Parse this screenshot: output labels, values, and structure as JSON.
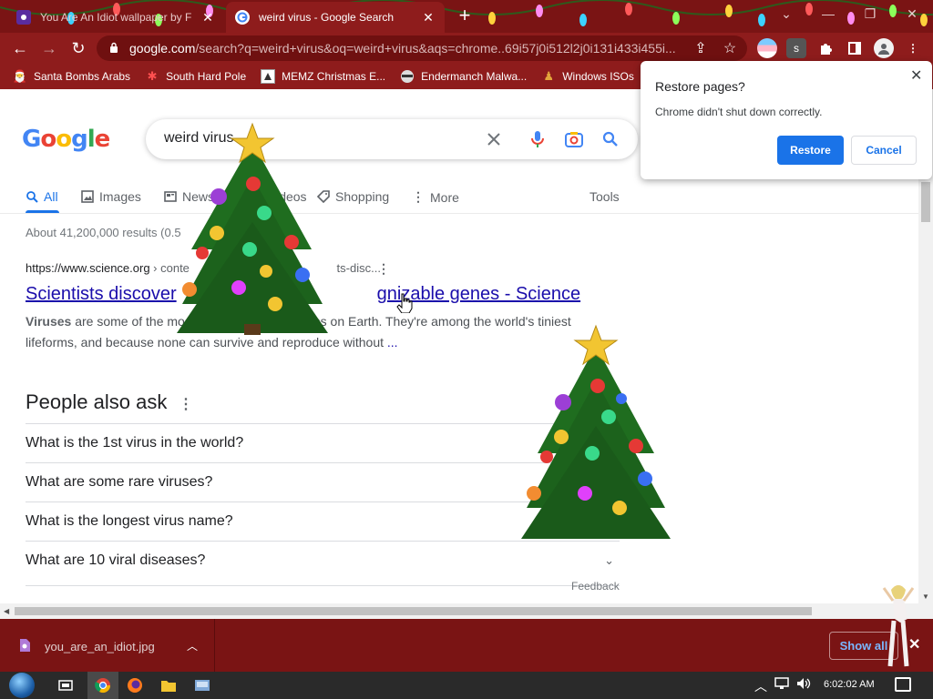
{
  "browser": {
    "tabs": [
      {
        "title": "You Are An Idiot wallpaper by F",
        "active": false
      },
      {
        "title": "weird virus - Google Search",
        "active": true
      }
    ],
    "new_tab": "+",
    "url_host": "google.com",
    "url_path": "/search?q=weird+virus&oq=weird+virus&aqs=chrome..69i57j0i512l2j0i131i433i455i...",
    "bookmarks": [
      {
        "label": "Santa Bombs Arabs",
        "icon": "santa-icon"
      },
      {
        "label": "South Hard Pole",
        "icon": "snowflake-icon"
      },
      {
        "label": "MEMZ Christmas E...",
        "icon": "memz-icon"
      },
      {
        "label": "Endermanch Malwa...",
        "icon": "raccoon-icon"
      },
      {
        "label": "Windows ISOs",
        "icon": "windows-user-icon"
      }
    ],
    "extension_letter": "s"
  },
  "search": {
    "query": "weird virus",
    "logo_letters": [
      "G",
      "o",
      "o",
      "g",
      "l",
      "e"
    ],
    "logo_colors": [
      "#4285f4",
      "#ea4335",
      "#fbbc05",
      "#4285f4",
      "#34a853",
      "#ea4335"
    ],
    "tabs": [
      {
        "label": "All",
        "icon": "search-icon",
        "selected": true
      },
      {
        "label": "Images",
        "icon": "image-icon"
      },
      {
        "label": "News",
        "icon": "news-icon"
      },
      {
        "label": "Videos",
        "icon": "video-icon"
      },
      {
        "label": "Shopping",
        "icon": "tag-icon"
      },
      {
        "label": "More",
        "icon": "more-vert-icon"
      }
    ],
    "tools": "Tools",
    "stats": "About 41,200,000 results (0.5",
    "result": {
      "cite_domain": "https://www.science.org",
      "cite_crumb": " › conte",
      "cite_tail": "ts-disc...",
      "title": "Scientists discover",
      "title_end": "gnizable genes - Science",
      "snippet_bold": "Viruses",
      "snippet_1": " are some of the most mysterio",
      "snippet_2": "ganisms on Earth. They're among the world's tiniest",
      "snippet_line2": "lifeforms, and because none can survive and reproduce without",
      "snippet_ellipsis": " ..."
    },
    "people_also_ask": {
      "title": "People also ask",
      "questions": [
        "What is the 1st virus in the world?",
        "What are some rare viruses?",
        "What is the longest virus name?",
        "What are 10 viral diseases?"
      ]
    },
    "feedback": "Feedback"
  },
  "restore_popup": {
    "title": "Restore pages?",
    "body": "Chrome didn't shut down correctly.",
    "restore_label": "Restore",
    "cancel_label": "Cancel"
  },
  "downloads": {
    "file": "you_are_an_idiot.jpg",
    "show_all": "Show all"
  },
  "taskbar": {
    "clock": "6:02:02 AM"
  },
  "colors": {
    "chrome_theme": "#8e1c1c",
    "link": "#1a0dab",
    "accent": "#1a73e8"
  }
}
